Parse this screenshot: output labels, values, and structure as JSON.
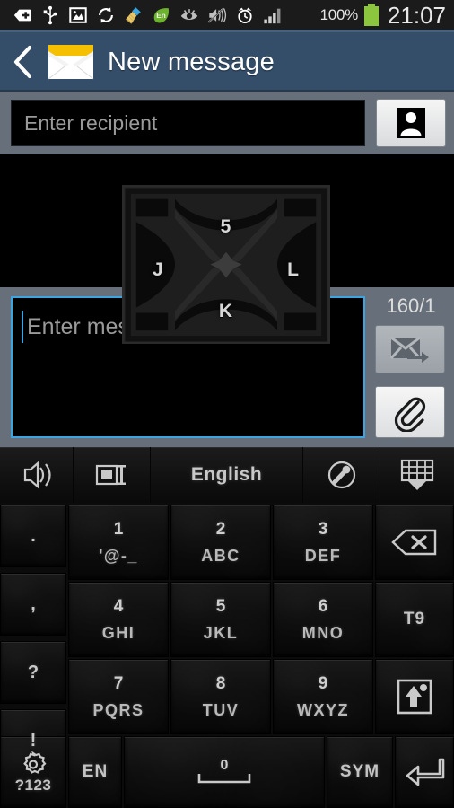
{
  "statusbar": {
    "icons": [
      {
        "name": "download-add-icon",
        "glyph": "plus-tag"
      },
      {
        "name": "usb-icon",
        "glyph": "usb"
      },
      {
        "name": "screenshot-image-icon",
        "glyph": "image"
      },
      {
        "name": "sync-icon",
        "glyph": "sync"
      },
      {
        "name": "cleaner-broom-icon",
        "glyph": "broom"
      },
      {
        "name": "english-keyboard-icon",
        "glyph": "leaf-en",
        "label": "En"
      },
      {
        "name": "smart-stay-eye-icon",
        "glyph": "eye"
      },
      {
        "name": "sound-mute-icon",
        "glyph": "mute"
      },
      {
        "name": "alarm-icon",
        "glyph": "alarm"
      },
      {
        "name": "signal-icon",
        "glyph": "signal"
      }
    ],
    "battery_percent": "100%",
    "clock": "21:07"
  },
  "actionbar": {
    "back_label": "Back",
    "app_icon": "envelope-icon",
    "title": "New message"
  },
  "recipient": {
    "placeholder": "Enter recipient",
    "value": "",
    "contacts_button": "contacts-picker-button"
  },
  "composer": {
    "placeholder": "Enter message",
    "value": "",
    "counter": "160/1",
    "send_button": "send-message-button",
    "attach_button": "attach-button"
  },
  "t9_popup": {
    "top": "5",
    "left": "J",
    "right": "L",
    "bottom": "K"
  },
  "keyboard": {
    "toolbar": [
      {
        "name": "sound-settings-key",
        "icon": "speaker-icon",
        "label": ""
      },
      {
        "name": "text-select-key",
        "icon": "clipboard-icon",
        "label": ""
      },
      {
        "name": "language-key",
        "icon": "",
        "label": "English"
      },
      {
        "name": "voice-input-key",
        "icon": "microphone-icon",
        "label": ""
      },
      {
        "name": "hide-keyboard-key",
        "icon": "keyboard-down-icon",
        "label": ""
      }
    ],
    "left_column": [
      {
        "name": "period-key",
        "label": "."
      },
      {
        "name": "comma-key",
        "label": ","
      },
      {
        "name": "question-key",
        "label": "?"
      },
      {
        "name": "exclamation-key",
        "label": "!"
      }
    ],
    "rows": [
      [
        {
          "name": "key-1",
          "num": "1",
          "sub": "'@-_"
        },
        {
          "name": "key-2",
          "num": "2",
          "sub": "ABC"
        },
        {
          "name": "key-3",
          "num": "3",
          "sub": "DEF"
        }
      ],
      [
        {
          "name": "key-4",
          "num": "4",
          "sub": "GHI"
        },
        {
          "name": "key-5",
          "num": "5",
          "sub": "JKL"
        },
        {
          "name": "key-6",
          "num": "6",
          "sub": "MNO"
        }
      ],
      [
        {
          "name": "key-7",
          "num": "7",
          "sub": "PQRS"
        },
        {
          "name": "key-8",
          "num": "8",
          "sub": "TUV"
        },
        {
          "name": "key-9",
          "num": "9",
          "sub": "WXYZ"
        }
      ]
    ],
    "right_column": [
      {
        "name": "backspace-key",
        "icon": "backspace-icon",
        "label": ""
      },
      {
        "name": "t9-key",
        "icon": "",
        "label": "T9"
      },
      {
        "name": "shift-key",
        "icon": "shift-icon",
        "label": ""
      },
      {
        "name": "enter-key",
        "icon": "enter-icon",
        "label": ""
      }
    ],
    "bottom_row": {
      "settings": {
        "name": "settings-symbols-key",
        "icon": "gear-icon",
        "label": "?123"
      },
      "lang": {
        "name": "language-toggle-key",
        "label": "EN"
      },
      "space": {
        "name": "space-key",
        "label": "0"
      },
      "sym": {
        "name": "symbols-key",
        "label": "SYM"
      },
      "enter": {
        "name": "enter-key-bottom",
        "icon": "enter-icon",
        "label": ""
      }
    }
  },
  "colors": {
    "actionbar": "#344d68",
    "chrome": "#67707a",
    "focus": "#3aa5e0",
    "battery": "#8cc63e",
    "envelope": "#f4c000"
  }
}
